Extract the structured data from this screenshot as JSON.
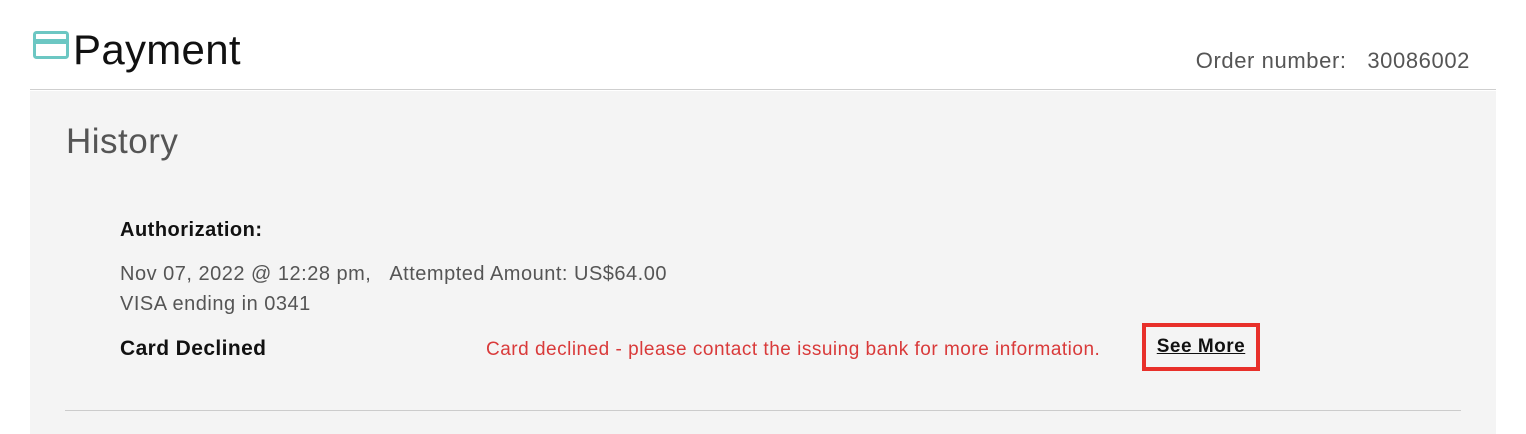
{
  "header": {
    "title": "Payment",
    "icon": "credit-card-icon",
    "icon_color": "#6cc7c3",
    "order_label": "Order number:",
    "order_number": "30086002"
  },
  "history": {
    "title": "History",
    "authorization": {
      "label": "Authorization:",
      "datetime": "Nov 07, 2022 @ 12:28 pm,",
      "attempted_amount": "Attempted Amount: US$64.00",
      "card": "VISA ending in 0341",
      "status": "Card Declined",
      "message": "Card declined - please contact the issuing bank for more information.",
      "message_color": "#d93a3a",
      "see_more_label": "See More",
      "highlight_color": "#e8302a"
    }
  }
}
